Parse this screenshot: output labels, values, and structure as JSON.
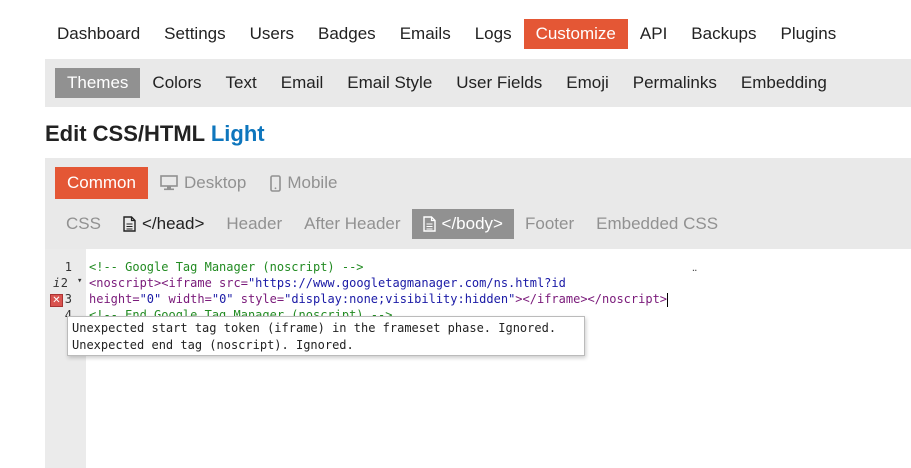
{
  "nav": {
    "items": [
      "Dashboard",
      "Settings",
      "Users",
      "Badges",
      "Emails",
      "Logs",
      "Customize",
      "API",
      "Backups",
      "Plugins"
    ],
    "active": "Customize"
  },
  "subnav": {
    "items": [
      "Themes",
      "Colors",
      "Text",
      "Email",
      "Email Style",
      "User Fields",
      "Emoji",
      "Permalinks",
      "Embedding"
    ],
    "active": "Themes"
  },
  "title": {
    "prefix": "Edit CSS/HTML",
    "theme": "Light"
  },
  "target_tabs": [
    "Common",
    "Desktop",
    "Mobile"
  ],
  "field_tabs": [
    "CSS",
    "</head>",
    "Header",
    "After Header",
    "</body>",
    "Footer",
    "Embedded CSS"
  ],
  "editor": {
    "line_numbers": [
      "1",
      "2",
      "3",
      "4"
    ],
    "fold_marker": "▾",
    "info_marker": "i",
    "error_marker": "✕",
    "line1": "<!-- Google Tag Manager (noscript) -->",
    "line2_tag1": "<noscript>",
    "line2_tag2": "<iframe",
    "line2_attr": " src=",
    "line2_str": "\"https://www.googletagmanager.com/ns.html?id",
    "line3_attr1": "height=",
    "line3_str1": "\"0\"",
    "line3_attr2": " width=",
    "line3_str2": "\"0\"",
    "line3_attr3": " style=",
    "line3_str3": "\"display:none;visibility:hidden\"",
    "line3_tag": "></iframe></noscript>",
    "line4_partial": "<!-- End Google Tag Manager (noscript) -->",
    "overflow_mark": "̈",
    "tooltip_line1": "Unexpected start tag token (iframe) in the frameset phase. Ignored.",
    "tooltip_line2": "Unexpected end tag (noscript). Ignored."
  },
  "colors": {
    "accent": "#e45735",
    "link": "#0e76bd",
    "active_gray": "#919191",
    "panel": "#e9e9e9"
  }
}
